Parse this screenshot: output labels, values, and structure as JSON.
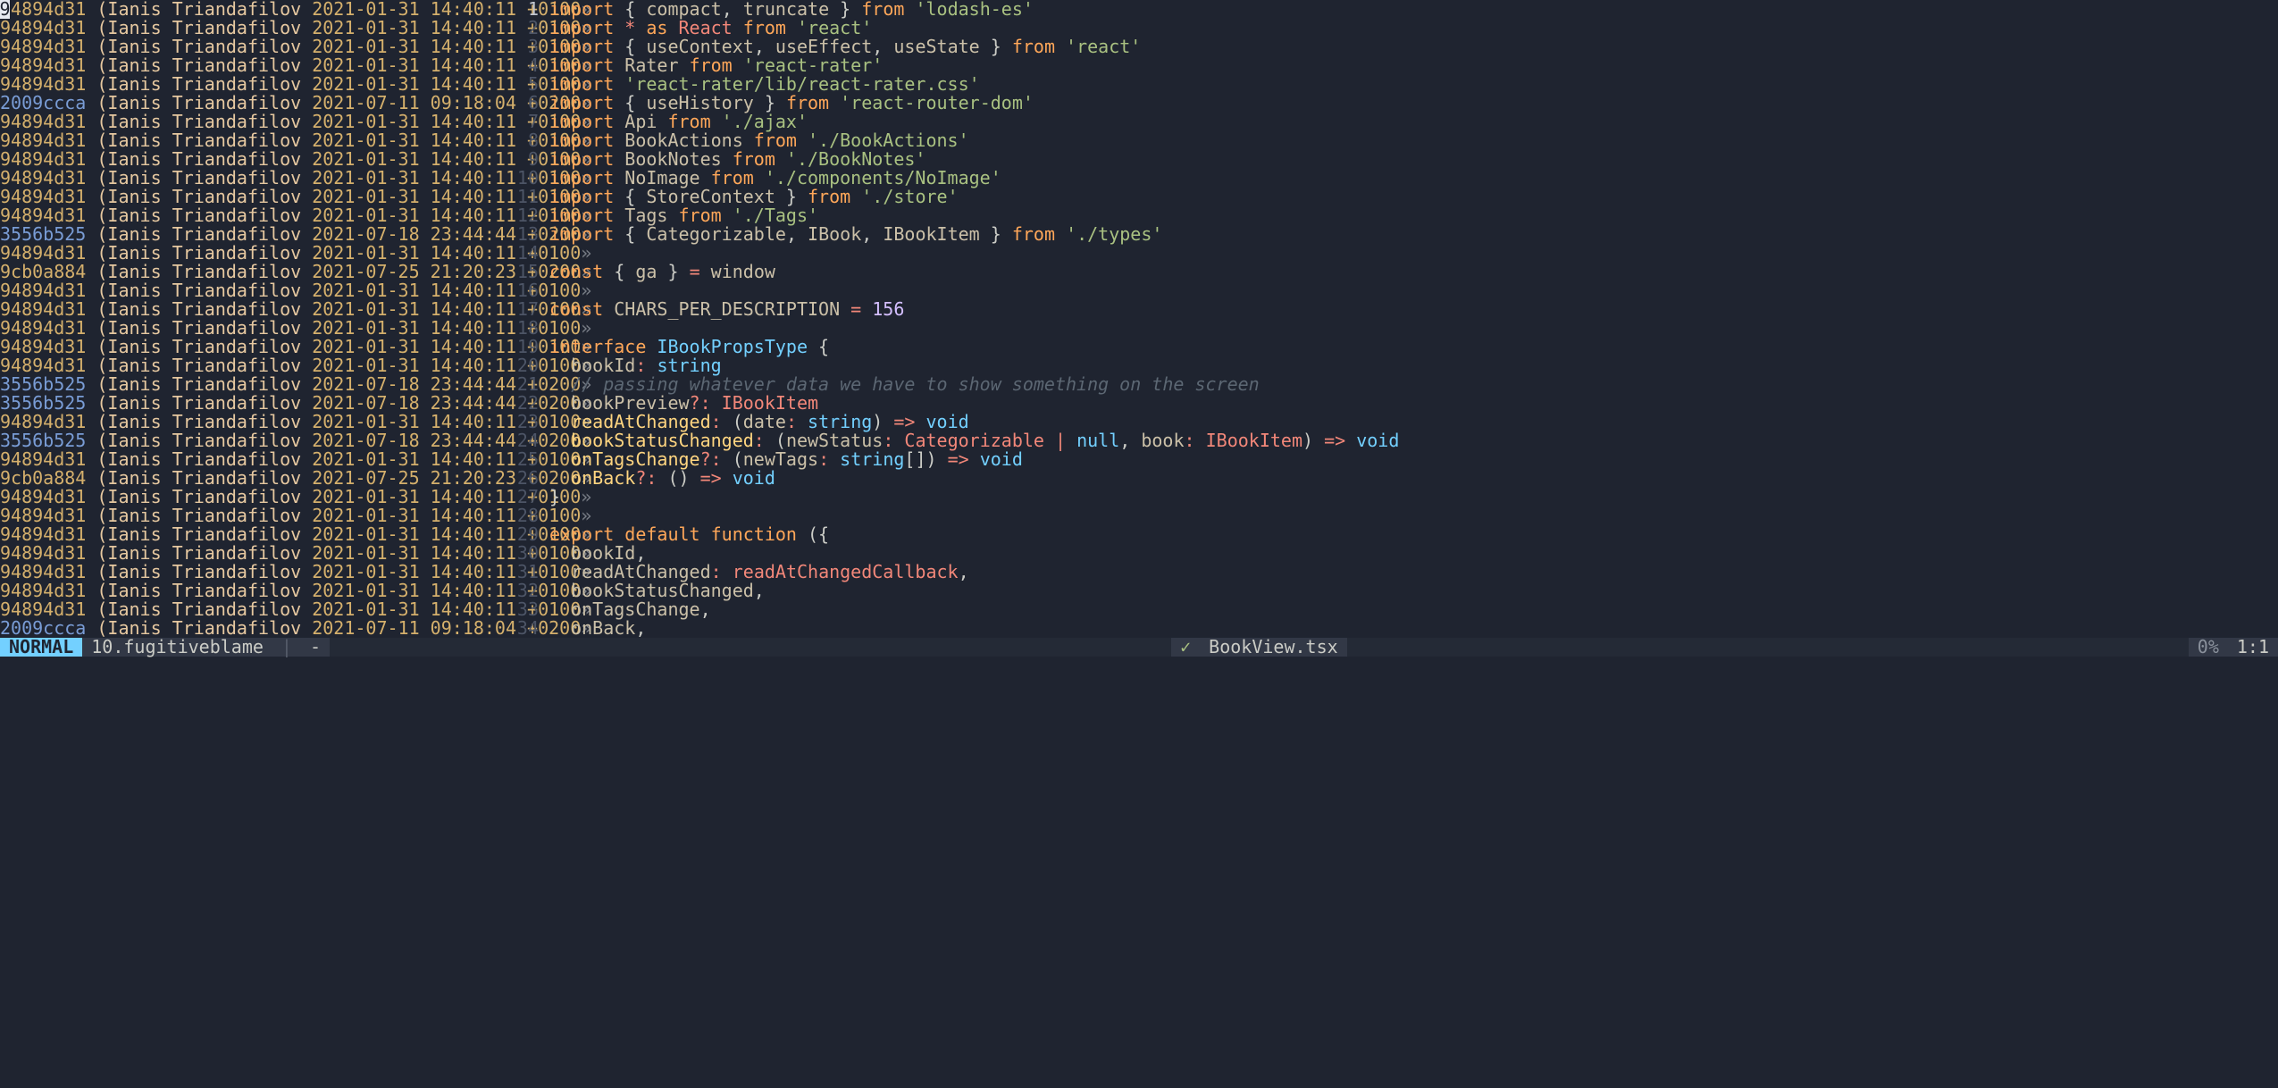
{
  "cursor_char": "9",
  "blame": [
    {
      "hash": "94894d31",
      "alt": false,
      "author": "Ianis Triandafilov",
      "date": "2021-01-31 14:40:11 +0100"
    },
    {
      "hash": "94894d31",
      "alt": false,
      "author": "Ianis Triandafilov",
      "date": "2021-01-31 14:40:11 +0100"
    },
    {
      "hash": "94894d31",
      "alt": false,
      "author": "Ianis Triandafilov",
      "date": "2021-01-31 14:40:11 +0100"
    },
    {
      "hash": "94894d31",
      "alt": false,
      "author": "Ianis Triandafilov",
      "date": "2021-01-31 14:40:11 +0100"
    },
    {
      "hash": "94894d31",
      "alt": false,
      "author": "Ianis Triandafilov",
      "date": "2021-01-31 14:40:11 +0100"
    },
    {
      "hash": "2009ccca",
      "alt": true,
      "author": "Ianis Triandafilov",
      "date": "2021-07-11 09:18:04 +0200"
    },
    {
      "hash": "94894d31",
      "alt": false,
      "author": "Ianis Triandafilov",
      "date": "2021-01-31 14:40:11 +0100"
    },
    {
      "hash": "94894d31",
      "alt": false,
      "author": "Ianis Triandafilov",
      "date": "2021-01-31 14:40:11 +0100"
    },
    {
      "hash": "94894d31",
      "alt": false,
      "author": "Ianis Triandafilov",
      "date": "2021-01-31 14:40:11 +0100"
    },
    {
      "hash": "94894d31",
      "alt": false,
      "author": "Ianis Triandafilov",
      "date": "2021-01-31 14:40:11 +0100"
    },
    {
      "hash": "94894d31",
      "alt": false,
      "author": "Ianis Triandafilov",
      "date": "2021-01-31 14:40:11 +0100"
    },
    {
      "hash": "94894d31",
      "alt": false,
      "author": "Ianis Triandafilov",
      "date": "2021-01-31 14:40:11 +0100"
    },
    {
      "hash": "3556b525",
      "alt": true,
      "author": "Ianis Triandafilov",
      "date": "2021-07-18 23:44:44 +0200"
    },
    {
      "hash": "94894d31",
      "alt": false,
      "author": "Ianis Triandafilov",
      "date": "2021-01-31 14:40:11 +0100"
    },
    {
      "hash": "9cb0a884",
      "alt": false,
      "author": "Ianis Triandafilov",
      "date": "2021-07-25 21:20:23 +0200"
    },
    {
      "hash": "94894d31",
      "alt": false,
      "author": "Ianis Triandafilov",
      "date": "2021-01-31 14:40:11 +0100"
    },
    {
      "hash": "94894d31",
      "alt": false,
      "author": "Ianis Triandafilov",
      "date": "2021-01-31 14:40:11 +0100"
    },
    {
      "hash": "94894d31",
      "alt": false,
      "author": "Ianis Triandafilov",
      "date": "2021-01-31 14:40:11 +0100"
    },
    {
      "hash": "94894d31",
      "alt": false,
      "author": "Ianis Triandafilov",
      "date": "2021-01-31 14:40:11 +0100"
    },
    {
      "hash": "94894d31",
      "alt": false,
      "author": "Ianis Triandafilov",
      "date": "2021-01-31 14:40:11 +0100"
    },
    {
      "hash": "3556b525",
      "alt": true,
      "author": "Ianis Triandafilov",
      "date": "2021-07-18 23:44:44 +0200"
    },
    {
      "hash": "3556b525",
      "alt": true,
      "author": "Ianis Triandafilov",
      "date": "2021-07-18 23:44:44 +0200"
    },
    {
      "hash": "94894d31",
      "alt": false,
      "author": "Ianis Triandafilov",
      "date": "2021-01-31 14:40:11 +0100"
    },
    {
      "hash": "3556b525",
      "alt": true,
      "author": "Ianis Triandafilov",
      "date": "2021-07-18 23:44:44 +0200"
    },
    {
      "hash": "94894d31",
      "alt": false,
      "author": "Ianis Triandafilov",
      "date": "2021-01-31 14:40:11 +0100"
    },
    {
      "hash": "9cb0a884",
      "alt": false,
      "author": "Ianis Triandafilov",
      "date": "2021-07-25 21:20:23 +0200"
    },
    {
      "hash": "94894d31",
      "alt": false,
      "author": "Ianis Triandafilov",
      "date": "2021-01-31 14:40:11 +0100"
    },
    {
      "hash": "94894d31",
      "alt": false,
      "author": "Ianis Triandafilov",
      "date": "2021-01-31 14:40:11 +0100"
    },
    {
      "hash": "94894d31",
      "alt": false,
      "author": "Ianis Triandafilov",
      "date": "2021-01-31 14:40:11 +0100"
    },
    {
      "hash": "94894d31",
      "alt": false,
      "author": "Ianis Triandafilov",
      "date": "2021-01-31 14:40:11 +0100"
    },
    {
      "hash": "94894d31",
      "alt": false,
      "author": "Ianis Triandafilov",
      "date": "2021-01-31 14:40:11 +0100"
    },
    {
      "hash": "94894d31",
      "alt": false,
      "author": "Ianis Triandafilov",
      "date": "2021-01-31 14:40:11 +0100"
    },
    {
      "hash": "94894d31",
      "alt": false,
      "author": "Ianis Triandafilov",
      "date": "2021-01-31 14:40:11 +0100"
    },
    {
      "hash": "2009ccca",
      "alt": true,
      "author": "Ianis Triandafilov",
      "date": "2021-07-11 09:18:04 +0200"
    }
  ],
  "code": [
    {
      "n": 1,
      "current": true,
      "tokens": [
        [
          "key",
          "import "
        ],
        [
          "pun",
          "{ "
        ],
        [
          "name",
          "compact"
        ],
        [
          "pun",
          ", "
        ],
        [
          "name",
          "truncate"
        ],
        [
          "pun",
          " } "
        ],
        [
          "key",
          "from "
        ],
        [
          "str",
          "'lodash-es'"
        ]
      ]
    },
    {
      "n": 2,
      "tokens": [
        [
          "key",
          "import "
        ],
        [
          "op",
          "* "
        ],
        [
          "key",
          "as "
        ],
        [
          "type",
          "React"
        ],
        [
          "key",
          " from "
        ],
        [
          "str",
          "'react'"
        ]
      ]
    },
    {
      "n": 3,
      "tokens": [
        [
          "key",
          "import "
        ],
        [
          "pun",
          "{ "
        ],
        [
          "name",
          "useContext"
        ],
        [
          "pun",
          ", "
        ],
        [
          "name",
          "useEffect"
        ],
        [
          "pun",
          ", "
        ],
        [
          "name",
          "useState"
        ],
        [
          "pun",
          " } "
        ],
        [
          "key",
          "from "
        ],
        [
          "str",
          "'react'"
        ]
      ]
    },
    {
      "n": 4,
      "tokens": [
        [
          "key",
          "import "
        ],
        [
          "name",
          "Rater"
        ],
        [
          "key",
          " from "
        ],
        [
          "str",
          "'react-rater'"
        ]
      ]
    },
    {
      "n": 5,
      "tokens": [
        [
          "key",
          "import "
        ],
        [
          "str",
          "'react-rater/lib/react-rater.css'"
        ]
      ]
    },
    {
      "n": 6,
      "tokens": [
        [
          "key",
          "import "
        ],
        [
          "pun",
          "{ "
        ],
        [
          "name",
          "useHistory"
        ],
        [
          "pun",
          " } "
        ],
        [
          "key",
          "from "
        ],
        [
          "str",
          "'react-router-dom'"
        ]
      ]
    },
    {
      "n": 7,
      "tokens": [
        [
          "key",
          "import "
        ],
        [
          "name",
          "Api"
        ],
        [
          "key",
          " from "
        ],
        [
          "str",
          "'./ajax'"
        ]
      ]
    },
    {
      "n": 8,
      "tokens": [
        [
          "key",
          "import "
        ],
        [
          "name",
          "BookActions"
        ],
        [
          "key",
          " from "
        ],
        [
          "str",
          "'./BookActions'"
        ]
      ]
    },
    {
      "n": 9,
      "tokens": [
        [
          "key",
          "import "
        ],
        [
          "name",
          "BookNotes"
        ],
        [
          "key",
          " from "
        ],
        [
          "str",
          "'./BookNotes'"
        ]
      ]
    },
    {
      "n": 10,
      "tokens": [
        [
          "key",
          "import "
        ],
        [
          "name",
          "NoImage"
        ],
        [
          "key",
          " from "
        ],
        [
          "str",
          "'./components/NoImage'"
        ]
      ]
    },
    {
      "n": 11,
      "tokens": [
        [
          "key",
          "import "
        ],
        [
          "pun",
          "{ "
        ],
        [
          "name",
          "StoreContext"
        ],
        [
          "pun",
          " } "
        ],
        [
          "key",
          "from "
        ],
        [
          "str",
          "'./store'"
        ]
      ]
    },
    {
      "n": 12,
      "tokens": [
        [
          "key",
          "import "
        ],
        [
          "name",
          "Tags"
        ],
        [
          "key",
          " from "
        ],
        [
          "str",
          "'./Tags'"
        ]
      ]
    },
    {
      "n": 13,
      "tokens": [
        [
          "key",
          "import "
        ],
        [
          "pun",
          "{ "
        ],
        [
          "name",
          "Categorizable"
        ],
        [
          "pun",
          ", "
        ],
        [
          "name",
          "IBook"
        ],
        [
          "pun",
          ", "
        ],
        [
          "name",
          "IBookItem"
        ],
        [
          "pun",
          " } "
        ],
        [
          "key",
          "from "
        ],
        [
          "str",
          "'./types'"
        ]
      ]
    },
    {
      "n": 14,
      "tokens": []
    },
    {
      "n": 15,
      "tokens": [
        [
          "key",
          "const "
        ],
        [
          "pun",
          "{ "
        ],
        [
          "name",
          "ga"
        ],
        [
          "pun",
          " } "
        ],
        [
          "op",
          "= "
        ],
        [
          "name",
          "window"
        ]
      ]
    },
    {
      "n": 16,
      "tokens": []
    },
    {
      "n": 17,
      "tokens": [
        [
          "key",
          "const "
        ],
        [
          "name",
          "CHARS_PER_DESCRIPTION"
        ],
        [
          "op",
          " = "
        ],
        [
          "num",
          "156"
        ]
      ]
    },
    {
      "n": 18,
      "tokens": []
    },
    {
      "n": 19,
      "tokens": [
        [
          "key",
          "interface "
        ],
        [
          "id",
          "IBookPropsType"
        ],
        [
          "pun",
          " {"
        ]
      ]
    },
    {
      "n": 20,
      "tokens": [
        [
          "pun",
          "  "
        ],
        [
          "name",
          "bookId"
        ],
        [
          "op",
          ": "
        ],
        [
          "id",
          "string"
        ]
      ]
    },
    {
      "n": 21,
      "tokens": [
        [
          "pun",
          "  "
        ],
        [
          "cmt",
          "// passing whatever data we have to show something on the screen"
        ]
      ]
    },
    {
      "n": 22,
      "tokens": [
        [
          "pun",
          "  "
        ],
        [
          "name",
          "bookPreview"
        ],
        [
          "op",
          "?: "
        ],
        [
          "type",
          "IBookItem"
        ]
      ]
    },
    {
      "n": 23,
      "tokens": [
        [
          "pun",
          "  "
        ],
        [
          "def",
          "readAtChanged"
        ],
        [
          "op",
          ": "
        ],
        [
          "pun",
          "("
        ],
        [
          "name",
          "date"
        ],
        [
          "op",
          ": "
        ],
        [
          "id",
          "string"
        ],
        [
          "pun",
          ") "
        ],
        [
          "op",
          "=> "
        ],
        [
          "id",
          "void"
        ]
      ]
    },
    {
      "n": 24,
      "tokens": [
        [
          "pun",
          "  "
        ],
        [
          "def",
          "bookStatusChanged"
        ],
        [
          "op",
          ": "
        ],
        [
          "pun",
          "("
        ],
        [
          "name",
          "newStatus"
        ],
        [
          "op",
          ": "
        ],
        [
          "type",
          "Categorizable"
        ],
        [
          "op",
          " | "
        ],
        [
          "id",
          "null"
        ],
        [
          "pun",
          ", "
        ],
        [
          "name",
          "book"
        ],
        [
          "op",
          ": "
        ],
        [
          "type",
          "IBookItem"
        ],
        [
          "pun",
          ") "
        ],
        [
          "op",
          "=> "
        ],
        [
          "id",
          "void"
        ]
      ]
    },
    {
      "n": 25,
      "tokens": [
        [
          "pun",
          "  "
        ],
        [
          "def",
          "onTagsChange"
        ],
        [
          "op",
          "?: "
        ],
        [
          "pun",
          "("
        ],
        [
          "name",
          "newTags"
        ],
        [
          "op",
          ": "
        ],
        [
          "id",
          "string"
        ],
        [
          "pun",
          "[]"
        ],
        [
          "pun",
          ") "
        ],
        [
          "op",
          "=> "
        ],
        [
          "id",
          "void"
        ]
      ]
    },
    {
      "n": 26,
      "tokens": [
        [
          "pun",
          "  "
        ],
        [
          "def",
          "onBack"
        ],
        [
          "op",
          "?: "
        ],
        [
          "pun",
          "() "
        ],
        [
          "op",
          "=> "
        ],
        [
          "id",
          "void"
        ]
      ]
    },
    {
      "n": 27,
      "tokens": [
        [
          "pun",
          "}"
        ]
      ]
    },
    {
      "n": 28,
      "tokens": []
    },
    {
      "n": 29,
      "tokens": [
        [
          "key",
          "export "
        ],
        [
          "key",
          "default "
        ],
        [
          "key",
          "function "
        ],
        [
          "pun",
          "({"
        ]
      ]
    },
    {
      "n": 30,
      "tokens": [
        [
          "pun",
          "  "
        ],
        [
          "name",
          "bookId"
        ],
        [
          "pun",
          ","
        ]
      ]
    },
    {
      "n": 31,
      "tokens": [
        [
          "pun",
          "  "
        ],
        [
          "name",
          "readAtChanged"
        ],
        [
          "op",
          ": "
        ],
        [
          "type",
          "readAtChangedCallback"
        ],
        [
          "pun",
          ","
        ]
      ]
    },
    {
      "n": 32,
      "tokens": [
        [
          "pun",
          "  "
        ],
        [
          "name",
          "bookStatusChanged"
        ],
        [
          "pun",
          ","
        ]
      ]
    },
    {
      "n": 33,
      "tokens": [
        [
          "pun",
          "  "
        ],
        [
          "name",
          "onTagsChange"
        ],
        [
          "pun",
          ","
        ]
      ]
    },
    {
      "n": 34,
      "tokens": [
        [
          "pun",
          "  "
        ],
        [
          "name",
          "onBack"
        ],
        [
          "pun",
          ","
        ]
      ]
    }
  ],
  "statusbar": {
    "mode": "NORMAL",
    "left_file": "10.fugitiveblame",
    "sep": "|",
    "dash": "-",
    "check": "✓",
    "right_file": "BookView.tsx",
    "percent": "0%",
    "position": "1:1"
  }
}
